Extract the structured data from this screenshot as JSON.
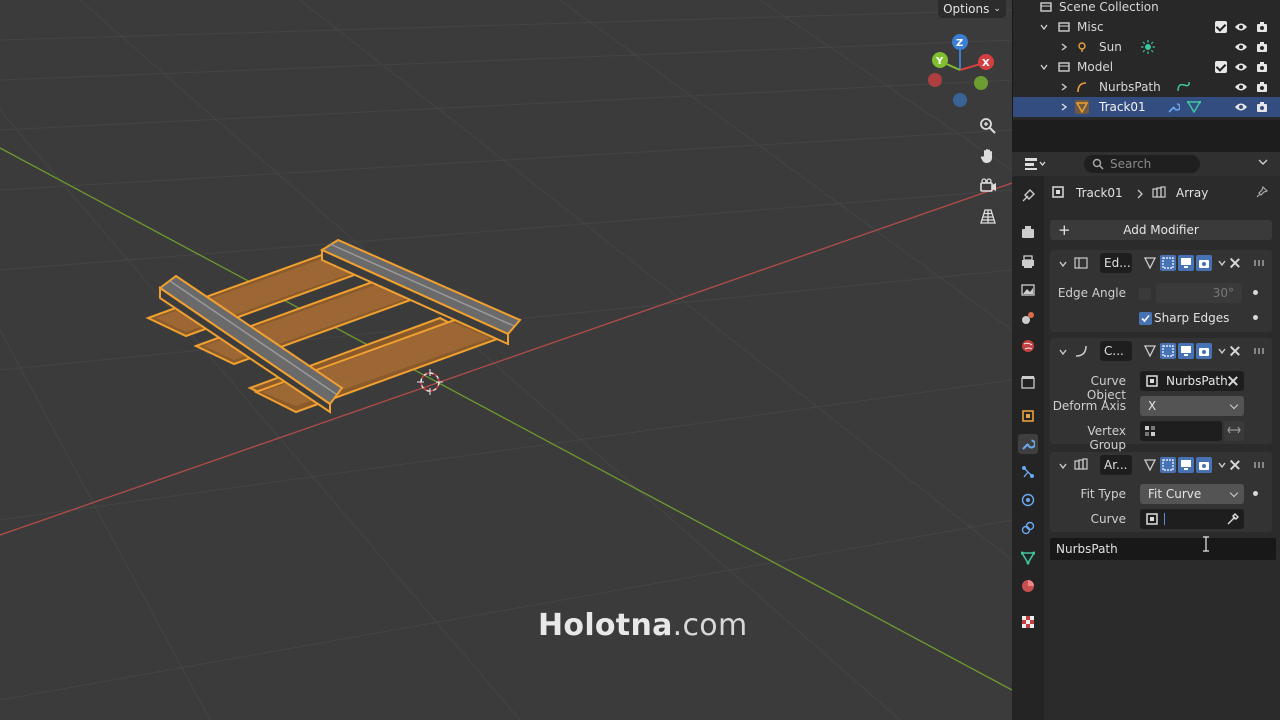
{
  "viewport": {
    "options_label": "Options",
    "watermark_brand": "Holotna",
    "watermark_domain": ".com",
    "gizmo": {
      "z": "Z",
      "y": "Y",
      "x": "X"
    },
    "colors": {
      "x_axis": "#d44040",
      "y_axis": "#7fbf30",
      "z_axis": "#3a7fd4",
      "selection_outline": "#f0a030"
    }
  },
  "outliner": {
    "rows": [
      {
        "label": "Scene Collection",
        "icon": "scene-collection-icon"
      },
      {
        "label": "Misc",
        "icon": "collection-icon"
      },
      {
        "label": "Sun",
        "icon": "light-icon"
      },
      {
        "label": "Model",
        "icon": "collection-icon"
      },
      {
        "label": "NurbsPath",
        "icon": "curve-icon"
      },
      {
        "label": "Track01",
        "icon": "mesh-icon",
        "selected": true
      }
    ]
  },
  "properties": {
    "search_placeholder": "Search",
    "breadcrumb": {
      "object": "Track01",
      "modifier": "Array"
    },
    "add_modifier_label": "Add Modifier",
    "modifiers": [
      {
        "short_name": "Ed...",
        "fields": {
          "edge_angle_label": "Edge Angle",
          "edge_angle_value": "30°",
          "sharp_edges_label": "Sharp Edges"
        }
      },
      {
        "short_name": "C...",
        "fields": {
          "curve_object_label": "Curve Object",
          "curve_object_value": "NurbsPath",
          "deform_axis_label": "Deform Axis",
          "deform_axis_value": "X",
          "vertex_group_label": "Vertex Group"
        }
      },
      {
        "short_name": "Ar...",
        "fields": {
          "fit_type_label": "Fit Type",
          "fit_type_value": "Fit Curve",
          "curve_label": "Curve"
        }
      }
    ],
    "dropdown_items": [
      "NurbsPath"
    ]
  }
}
